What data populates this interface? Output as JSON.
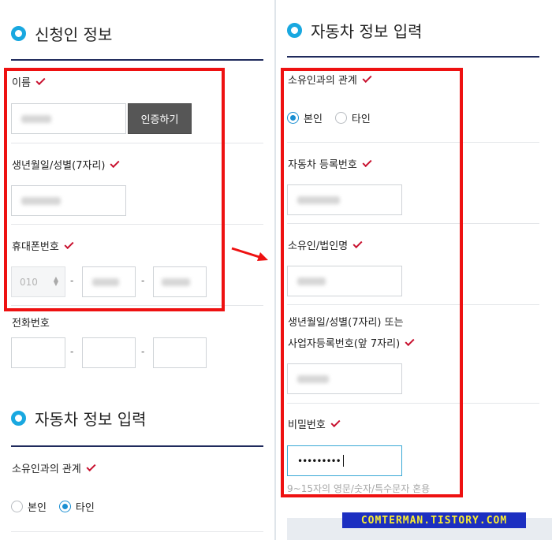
{
  "left": {
    "applicant_title": "신청인 정보",
    "name_label": "이름",
    "auth_button": "인증하기",
    "birth_label": "생년월일/성별(7자리)",
    "mobile_label": "휴대폰번호",
    "mobile_prefix": "010",
    "phone_label": "전화번호",
    "dash": "-",
    "vehicle_title": "자동차 정보 입력",
    "relation_label": "소유인과의 관계",
    "relation_options": [
      "본인",
      "타인"
    ],
    "relation_selected": "타인"
  },
  "right": {
    "vehicle_title": "자동차 정보 입력",
    "relation_label": "소유인과의 관계",
    "relation_options": [
      "본인",
      "타인"
    ],
    "relation_selected": "본인",
    "plate_label": "자동차 등록번호",
    "owner_label": "소유인/법인명",
    "birth_label_line1": "생년월일/성별(7자리) 또는",
    "birth_label_line2": "사업자등록번호(앞 7자리)",
    "password_label": "비밀번호",
    "password_value": "•••••••••",
    "password_hint": "9~15자의 영문/숫자/특수문자 혼용"
  },
  "watermark": "COMTERMAN.TISTORY.COM",
  "colors": {
    "accent": "#19a8e0",
    "check": "#c8102e",
    "highlight_box": "#ee1111",
    "title_rule": "#1f2a5c",
    "radio_checked": "#1b8fd2"
  },
  "icons": {
    "check": "check-icon",
    "bullet": "bullet-icon",
    "arrow": "arrow-right-icon",
    "select": "spinner-arrows-icon"
  }
}
